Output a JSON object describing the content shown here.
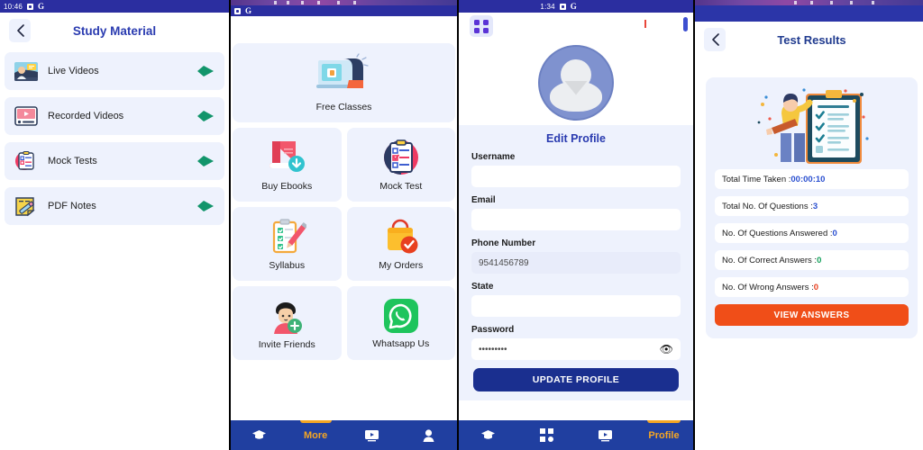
{
  "colors": {
    "brand_blue": "#2a3bb0",
    "nav_blue": "#203fa0",
    "status_blue": "#2b2ea0",
    "card_bg": "#eef2fd",
    "accent_orange": "#f04e18",
    "accent_amber": "#f5a623",
    "green_arrow": "#12956b"
  },
  "panel1": {
    "statusbar": {
      "time": "10:46",
      "icons": [
        "square-icon",
        "G"
      ]
    },
    "back_icon": "chevron-left-icon",
    "title": "Study Material",
    "items": [
      {
        "label": "Live Videos",
        "icon": "live-videos-icon",
        "arrow": "arrow-right-icon"
      },
      {
        "label": "Recorded Videos",
        "icon": "recorded-videos-icon",
        "arrow": "arrow-right-icon"
      },
      {
        "label": "Mock Tests",
        "icon": "mock-tests-icon",
        "arrow": "arrow-right-icon"
      },
      {
        "label": "PDF Notes",
        "icon": "pdf-notes-icon",
        "arrow": "arrow-right-icon"
      }
    ]
  },
  "panel2": {
    "statusbar": {
      "time": "",
      "icons": [
        "square-icon",
        "G"
      ]
    },
    "wide_card": {
      "label": "Free Classes",
      "icon": "free-classes-icon"
    },
    "cards": [
      {
        "label": "Buy Ebooks",
        "icon": "book-download-icon"
      },
      {
        "label": "Mock Test",
        "icon": "clipboard-check-icon"
      },
      {
        "label": "Syllabus",
        "icon": "syllabus-pencil-icon"
      },
      {
        "label": "My Orders",
        "icon": "shopping-bag-check-icon"
      },
      {
        "label": "Invite Friends",
        "icon": "invite-friend-icon"
      },
      {
        "label": "Whatsapp Us",
        "icon": "whatsapp-icon"
      }
    ],
    "bottom_nav": [
      {
        "label": "",
        "icon": "graduation-cap-icon",
        "active": false
      },
      {
        "label": "More",
        "icon": "",
        "active": true
      },
      {
        "label": "",
        "icon": "video-monitor-icon",
        "active": false
      },
      {
        "label": "",
        "icon": "person-icon",
        "active": false
      }
    ]
  },
  "panel3": {
    "statusbar": {
      "time": "1:34",
      "icons": [
        "square-icon",
        "G"
      ]
    },
    "grid_button_icon": "grid-apps-icon",
    "avatar_icon": "default-avatar-icon",
    "form_title": "Edit Profile",
    "fields": [
      {
        "label": "Username",
        "value": "",
        "placeholder": "",
        "filled": false,
        "type": "text"
      },
      {
        "label": "Email",
        "value": "",
        "placeholder": "",
        "filled": false,
        "type": "email"
      },
      {
        "label": "Phone Number",
        "value": "9541456789",
        "placeholder": "",
        "filled": true,
        "type": "tel"
      },
      {
        "label": "State",
        "value": "",
        "placeholder": "",
        "filled": false,
        "type": "text"
      },
      {
        "label": "Password",
        "value": "•••••••••",
        "placeholder": "",
        "filled": false,
        "type": "password",
        "trailing_icon": "eye-icon"
      }
    ],
    "update_button": "UPDATE PROFILE",
    "bottom_nav": [
      {
        "label": "",
        "icon": "graduation-cap-icon",
        "active": false
      },
      {
        "label": "",
        "icon": "grid-apps-icon",
        "active": false
      },
      {
        "label": "",
        "icon": "video-monitor-icon",
        "active": false
      },
      {
        "label": "Profile",
        "icon": "",
        "active": true
      }
    ]
  },
  "panel4": {
    "back_icon": "chevron-left-icon",
    "title": "Test Results",
    "illustration_icon": "test-results-illustration",
    "stats": [
      {
        "label": "Total Time Taken : ",
        "value": "00:00:10",
        "value_color": "#2a4fd0"
      },
      {
        "label": "Total No. Of Questions : ",
        "value": "3",
        "value_color": "#2a4fd0"
      },
      {
        "label": "No. Of Questions Answered : ",
        "value": "0",
        "value_color": "#2a4fd0"
      },
      {
        "label": "No. Of Correct Answers : ",
        "value": "0",
        "value_color": "#12a05a"
      },
      {
        "label": "No. Of Wrong Answers : ",
        "value": "0",
        "value_color": "#e8401f"
      }
    ],
    "view_button": "VIEW ANSWERS"
  }
}
